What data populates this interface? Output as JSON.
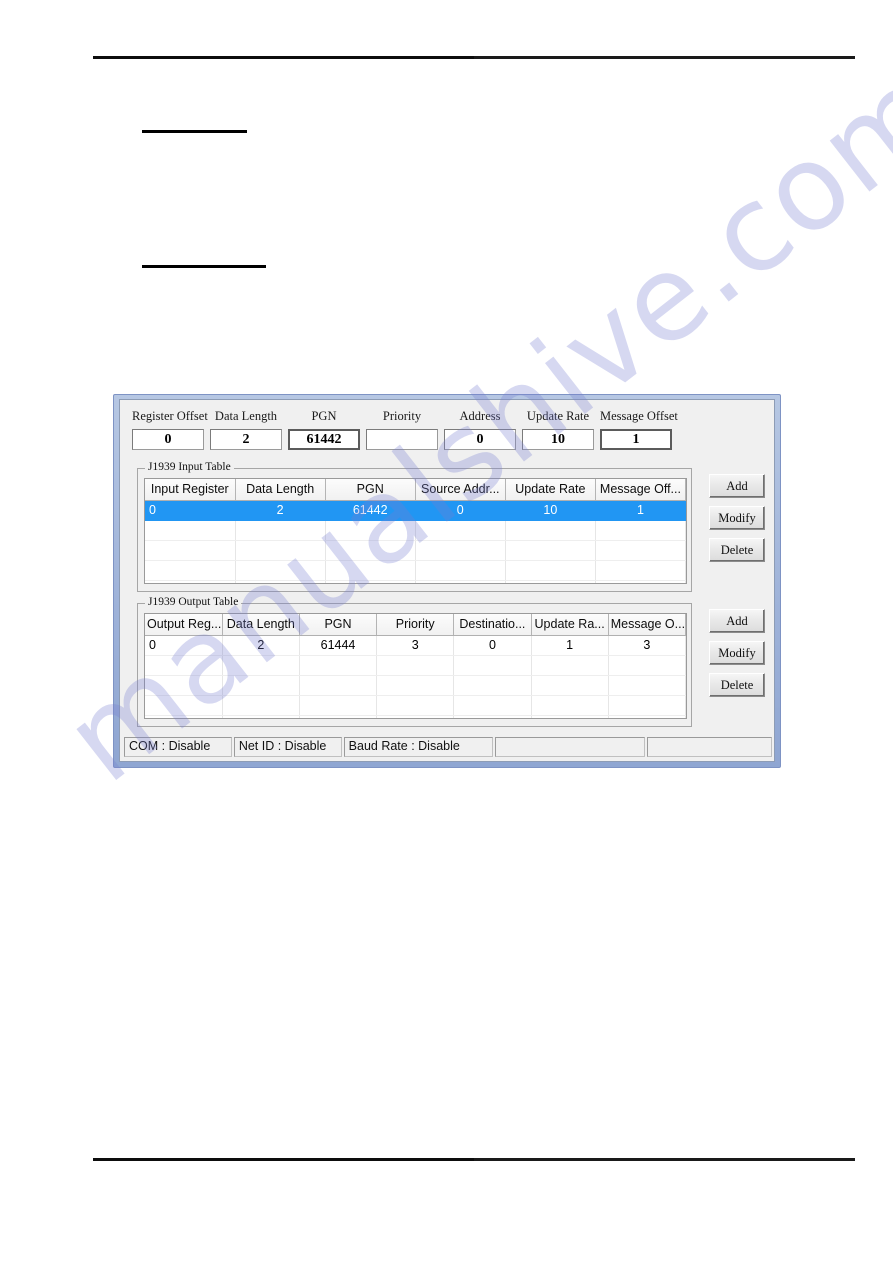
{
  "document": {
    "header_rule": "",
    "footer_rule": "",
    "heading_underline_1": "",
    "heading_underline_2": ""
  },
  "watermark": {
    "text": "manualshive.com",
    "color": "#787ed2"
  },
  "dialog": {
    "frame_color": "#9fb3d9",
    "client_color": "#f0f0f0",
    "params": [
      {
        "label": "Register Offset",
        "value": "0",
        "focused": false
      },
      {
        "label": "Data Length",
        "value": "2",
        "focused": false
      },
      {
        "label": "PGN",
        "value": "61442",
        "focused": true
      },
      {
        "label": "Priority",
        "value": "",
        "focused": false
      },
      {
        "label": "Address",
        "value": "0",
        "focused": false
      },
      {
        "label": "Update Rate",
        "value": "10",
        "focused": false
      },
      {
        "label": "Message Offset",
        "value": "1",
        "focused": true
      }
    ],
    "input_table": {
      "title": "J1939 Input Table",
      "columns": [
        "Input Register",
        "Data Length",
        "PGN",
        "Source Addr...",
        "Update Rate",
        "Message Off..."
      ],
      "rows": [
        {
          "selected": true,
          "cells": [
            "0",
            "2",
            "61442",
            "0",
            "10",
            "1"
          ]
        },
        {
          "selected": false,
          "cells": [
            "",
            "",
            "",
            "",
            "",
            ""
          ]
        },
        {
          "selected": false,
          "cells": [
            "",
            "",
            "",
            "",
            "",
            ""
          ]
        },
        {
          "selected": false,
          "cells": [
            "",
            "",
            "",
            "",
            "",
            ""
          ]
        },
        {
          "selected": false,
          "cells": [
            "",
            "",
            "",
            "",
            "",
            ""
          ]
        }
      ],
      "buttons": [
        "Add",
        "Modify",
        "Delete"
      ]
    },
    "output_table": {
      "title": "J1939 Output Table",
      "columns": [
        "Output Reg...",
        "Data Length",
        "PGN",
        "Priority",
        "Destinatio...",
        "Update Ra...",
        "Message O..."
      ],
      "rows": [
        {
          "selected": false,
          "cells": [
            "0",
            "2",
            "61444",
            "3",
            "0",
            "1",
            "3"
          ]
        },
        {
          "selected": false,
          "cells": [
            "",
            "",
            "",
            "",
            "",
            "",
            ""
          ]
        },
        {
          "selected": false,
          "cells": [
            "",
            "",
            "",
            "",
            "",
            "",
            ""
          ]
        },
        {
          "selected": false,
          "cells": [
            "",
            "",
            "",
            "",
            "",
            "",
            ""
          ]
        },
        {
          "selected": false,
          "cells": [
            "",
            "",
            "",
            "",
            "",
            "",
            ""
          ]
        }
      ],
      "buttons": [
        "Add",
        "Modify",
        "Delete"
      ]
    },
    "statusbar": {
      "panels": [
        "COM : Disable",
        "Net ID : Disable",
        "Baud Rate : Disable",
        "",
        ""
      ]
    },
    "selection_color": "#2196f3"
  }
}
